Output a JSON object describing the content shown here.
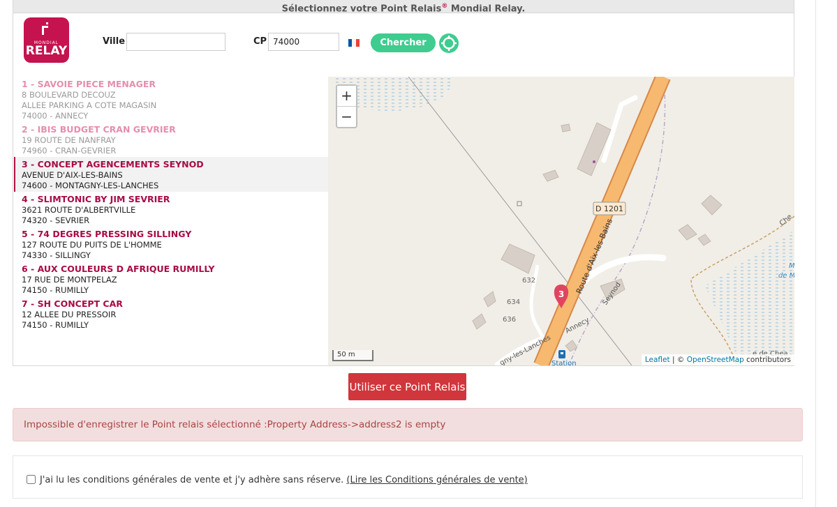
{
  "header": {
    "title_prefix": "Sélectionnez votre Point Relais",
    "title_reg": "®",
    "title_suffix": " Mondial Relay."
  },
  "logo": {
    "line1": "MONDIAL",
    "line2": "RELAY"
  },
  "search": {
    "city_label": "Ville",
    "city_value": "",
    "postcode_label": "CP",
    "postcode_value": "74000",
    "country_flag_icon": "france-flag-icon",
    "search_button": "Chercher",
    "locate_icon": "crosshair-icon"
  },
  "relays": [
    {
      "name": "1 - SAVOIE PIECE MENAGER",
      "lines": [
        "8 BOULEVARD DECOUZ",
        "ALLEE PARKING A COTE MAGASIN",
        "74000 - ANNECY"
      ],
      "state": "faded"
    },
    {
      "name": "2 - IBIS BUDGET CRAN GEVRIER",
      "lines": [
        "19 ROUTE DE NANFRAY",
        "74960 - CRAN-GEVRIER"
      ],
      "state": "faded"
    },
    {
      "name": "3 - CONCEPT AGENCEMENTS SEYNOD",
      "lines": [
        "AVENUE D'AIX-LES-BAINS",
        "74600 - MONTAGNY-LES-LANCHES"
      ],
      "state": "selected"
    },
    {
      "name": "4 - SLIMTONIC BY JIM SEVRIER",
      "lines": [
        "3621 ROUTE D'ALBERTVILLE",
        "74320 - SEVRIER"
      ],
      "state": "normal"
    },
    {
      "name": "5 - 74 DEGRES PRESSING SILLINGY",
      "lines": [
        "127 ROUTE DU PUITS DE L'HOMME",
        "74330 - SILLINGY"
      ],
      "state": "normal"
    },
    {
      "name": "6 - AUX COULEURS D AFRIQUE RUMILLY",
      "lines": [
        "17 RUE DE MONTPELAZ",
        "74150 - RUMILLY"
      ],
      "state": "normal"
    },
    {
      "name": "7 - SH CONCEPT CAR",
      "lines": [
        "12 ALLEE DU PRESSOIR",
        "74150 - RUMILLY"
      ],
      "state": "normal"
    }
  ],
  "map": {
    "zoom_in": "+",
    "zoom_out": "−",
    "road_badge": "D 1201",
    "road_name": "Route d'Aix-les-Bains",
    "marker_label": "3",
    "labels": {
      "seynod": "Seynod",
      "annecy": "Annecy",
      "lanches": "gny-les-Lanches",
      "station": "Station",
      "ches": "Che",
      "de_che": "e de Chea",
      "m_label": "M",
      "de_m": "de M"
    },
    "elevations": [
      "632",
      "634",
      "636"
    ],
    "scale": "50 m",
    "attribution_leaflet": "Leaflet",
    "attribution_sep": " | © ",
    "attribution_osm": "OpenStreetMap",
    "attribution_tail": " contributors"
  },
  "actions": {
    "use_button": "Utiliser ce Point Relais"
  },
  "alert": {
    "message": "Impossible d'enregistrer le Point relais sélectionné :Property Address->address2 is empty"
  },
  "terms": {
    "checked": false,
    "text": "J'ai lu les conditions générales de vente et j'y adhère sans réserve. ",
    "link": "(Lire les Conditions générales de vente)"
  },
  "colors": {
    "brand": "#c4134e",
    "green": "#3ecc8f",
    "danger": "#d0363b",
    "alert_bg": "#f2dede",
    "road": "#f6b96f"
  }
}
